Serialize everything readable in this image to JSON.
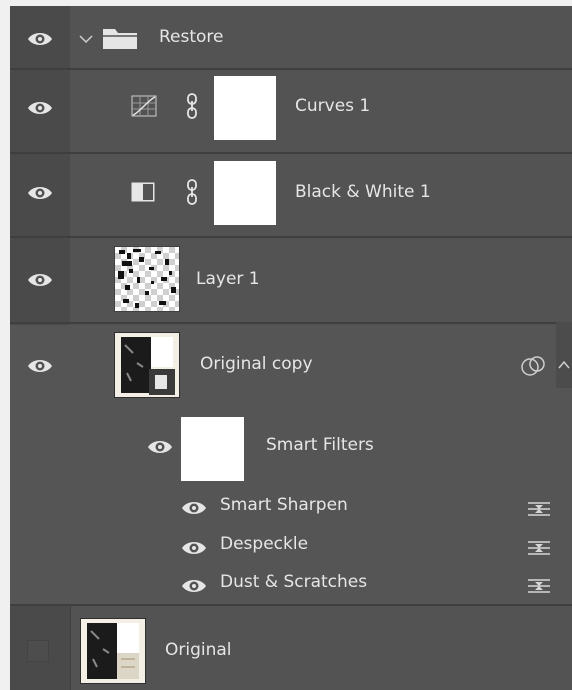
{
  "layers": {
    "group_restore": {
      "name": "Restore"
    },
    "curves": {
      "name": "Curves 1"
    },
    "black_white": {
      "name": "Black & White 1"
    },
    "layer1": {
      "name": "Layer 1"
    },
    "original_copy": {
      "name": "Original copy",
      "smart_filters": {
        "label": "Smart Filters",
        "filters": [
          {
            "name": "Smart Sharpen"
          },
          {
            "name": "Despeckle"
          },
          {
            "name": "Dust & Scratches"
          }
        ]
      }
    },
    "original": {
      "name": "Original"
    }
  },
  "colors": {
    "panel_bg": "#535353",
    "visibility_column": "#4a4a4a",
    "divider": "#3f3f3f",
    "text": "#e6e6e6"
  }
}
